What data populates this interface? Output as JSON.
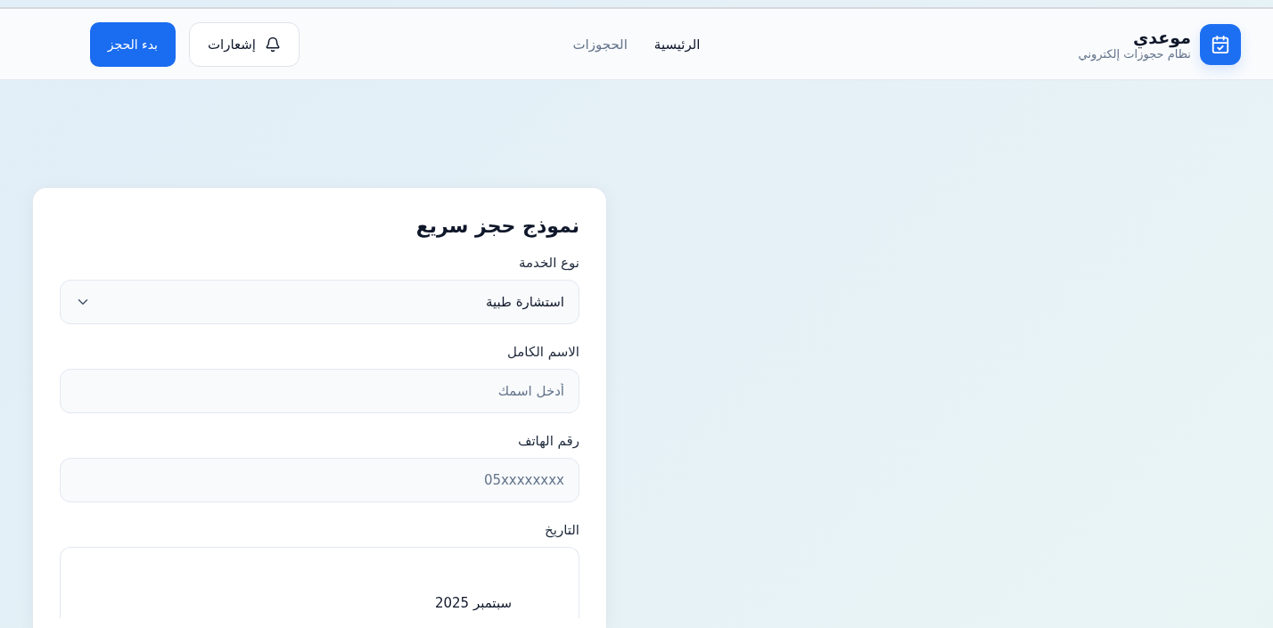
{
  "header": {
    "brand": {
      "title": "موعدي",
      "subtitle": "نظام حجوزات إلكتروني"
    },
    "nav": [
      {
        "label": "الرئيسية",
        "selected": true
      },
      {
        "label": "الحجوزات",
        "selected": false
      }
    ],
    "notifications_button": "إشعارات",
    "cta_button": "بدء الحجز"
  },
  "form": {
    "title": "نموذج حجز سريع",
    "fields": [
      {
        "kind": "select",
        "label": "نوع الخدمة",
        "value": "استشارة طبية"
      },
      {
        "kind": "text",
        "label": "الاسم الكامل",
        "placeholder": "أدخل اسمك"
      },
      {
        "kind": "text",
        "label": "رقم الهاتف",
        "placeholder": "05xxxxxxxx"
      },
      {
        "kind": "date",
        "label": "التاريخ",
        "month": "سبتمبر 2025"
      }
    ]
  }
}
